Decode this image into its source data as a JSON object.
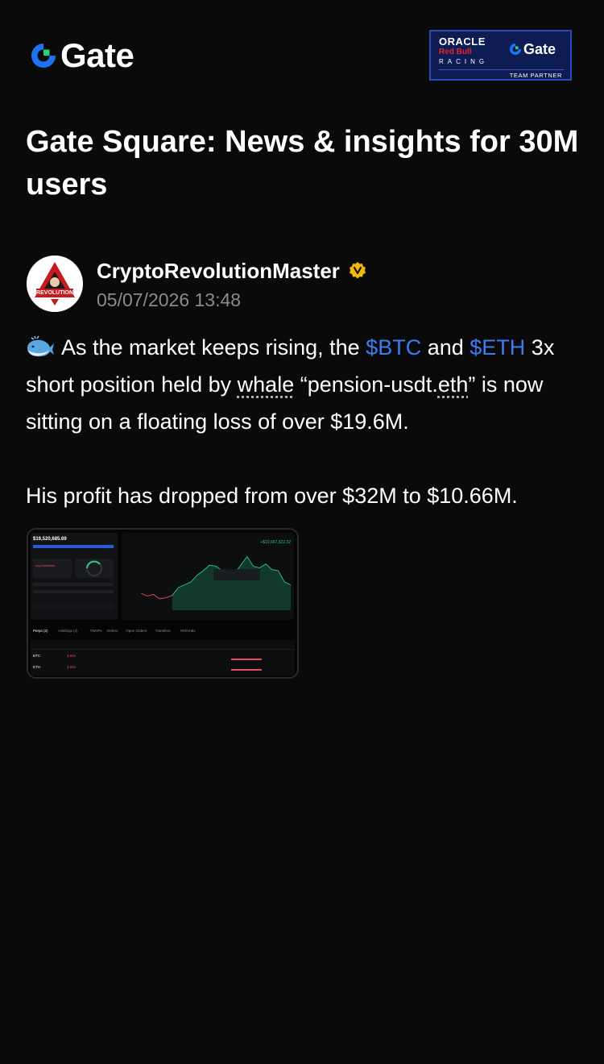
{
  "brand": {
    "name": "Gate",
    "accent": "#1d72f2"
  },
  "partner_badge": {
    "oracle": "ORACLE",
    "redbull": "Red Bull",
    "racing": "RACING",
    "gate": "Gate",
    "team_partner": "TEAM PARTNER"
  },
  "headline": "Gate Square: News & insights for 30M users",
  "post": {
    "author": "CryptoRevolutionMaster",
    "verified": true,
    "avatar_text": "REVOLUTION",
    "timestamp": "05/07/2026 13:48",
    "text": {
      "p1_a": "As the market keeps rising, the ",
      "tag_btc": "$BTC",
      "p1_b": "  and ",
      "tag_eth": "$ETH",
      "p1_c": " 3x short position held by ",
      "whale_word": "whale",
      "p1_d": " “pension-usdt.",
      "eth_word": "eth",
      "p1_e": "” is now sitting on a floating loss of over $19.6M.",
      "p2": "His profit has dropped from over $32M to $10.66M."
    },
    "attachment": {
      "balance": "$19,520,685.69",
      "pnl": "+$10,667,522.32",
      "tabs": [
        "Perps (2)",
        "Holdings (4)",
        "TWAPs",
        "Orders",
        "Open Orders",
        "Transfers",
        "Referrals"
      ],
      "rows": [
        {
          "asset": "BTC",
          "side": "3.00x"
        },
        {
          "asset": "ETH",
          "side": "3.00x"
        }
      ]
    }
  },
  "colors": {
    "background": "#0a0a0b",
    "link": "#3d7bf0",
    "muted": "#8a8a8f",
    "verified": "#f0b90b",
    "chart_green": "#2fc48d",
    "chart_red": "#e84a5f"
  }
}
